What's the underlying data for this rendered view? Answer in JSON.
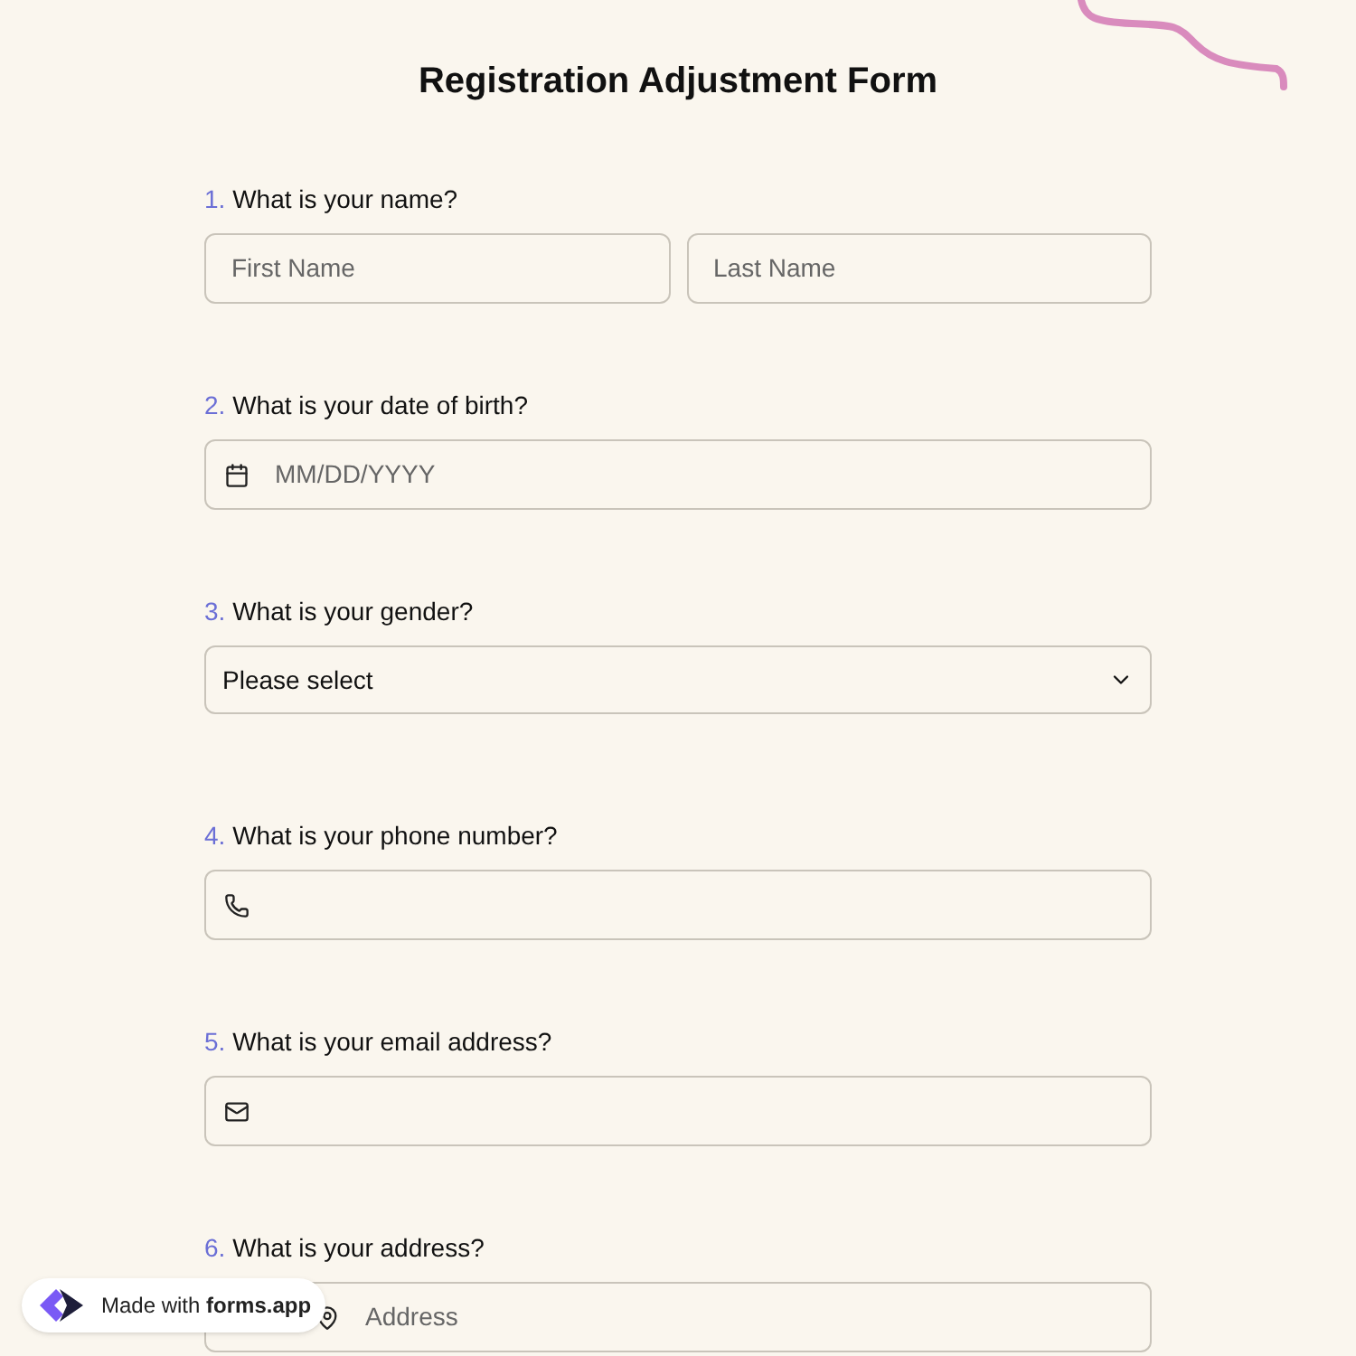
{
  "title": "Registration Adjustment Form",
  "questions": [
    {
      "number": "1.",
      "label": "What is your name?",
      "kind": "name",
      "fields": [
        {
          "placeholder": "First Name"
        },
        {
          "placeholder": "Last Name"
        }
      ]
    },
    {
      "number": "2.",
      "label": "What is your date of birth?",
      "kind": "date",
      "fields": [
        {
          "placeholder": "MM/DD/YYYY"
        }
      ]
    },
    {
      "number": "3.",
      "label": "What is your gender?",
      "kind": "select",
      "fields": [
        {
          "value": "Please select"
        }
      ]
    },
    {
      "number": "4.",
      "label": "What is your phone number?",
      "kind": "phone"
    },
    {
      "number": "5.",
      "label": "What is your email address?",
      "kind": "email"
    },
    {
      "number": "6.",
      "label": "What is your address?",
      "kind": "address",
      "fields": [
        {
          "placeholder": "Address"
        }
      ]
    }
  ],
  "badge": {
    "prefix": "Made with",
    "brand": "forms.app"
  }
}
